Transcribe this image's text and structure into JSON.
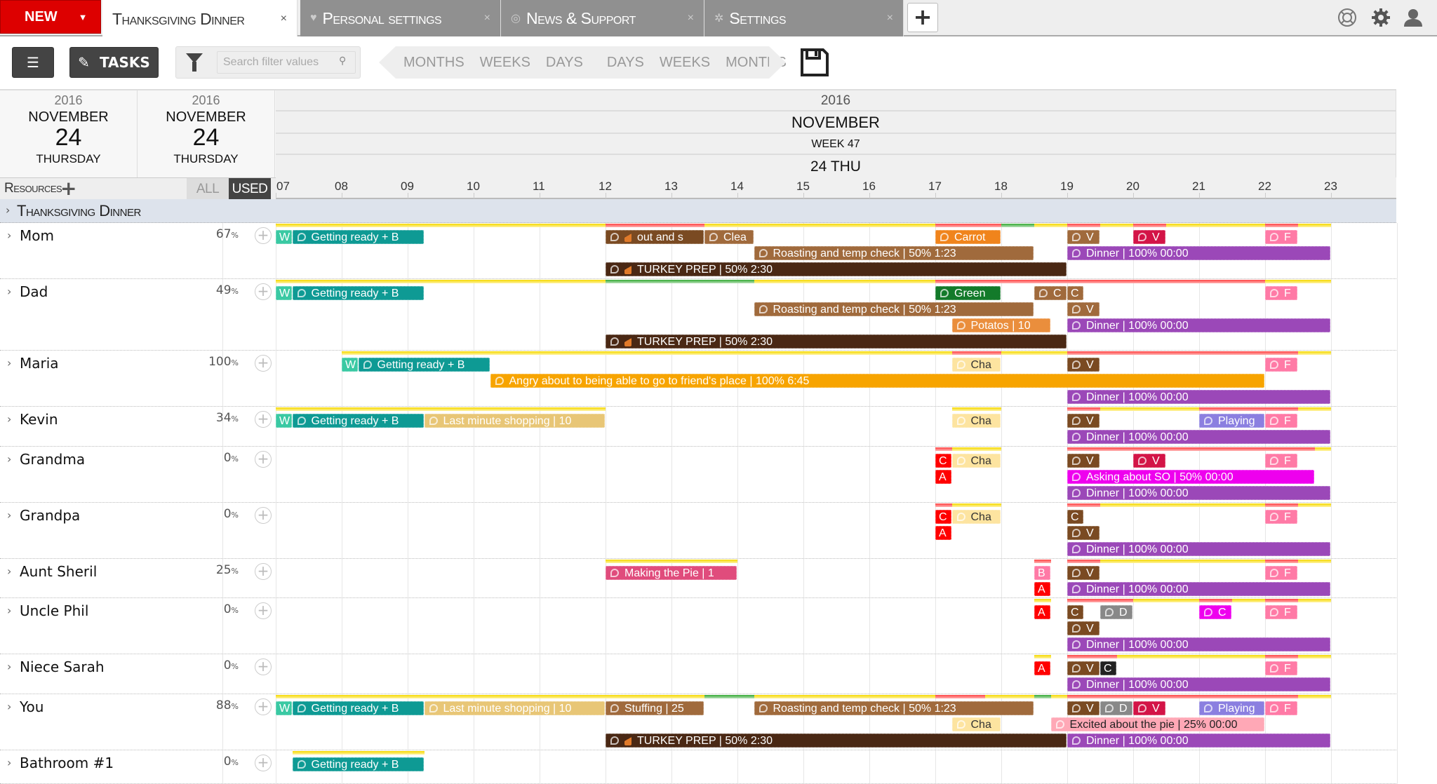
{
  "tabbar": {
    "new_label": "NEW",
    "tabs": [
      {
        "label": "Thanksgiving Dinner",
        "active": true,
        "icon": ""
      },
      {
        "label": "Personal settings",
        "active": false,
        "icon": "heart-icon"
      },
      {
        "label": "News & Support",
        "active": false,
        "icon": "lifebuoy-icon"
      },
      {
        "label": "Settings",
        "active": false,
        "icon": "gear-icon"
      }
    ],
    "close_glyph": "×",
    "add_glyph": "+"
  },
  "toolbar": {
    "tasks_label": "TASKS",
    "search_placeholder": "Search filter values",
    "zoom_out": [
      "MONTHS",
      "WEEKS",
      "DAYS"
    ],
    "zoom_in": [
      "DAYS",
      "WEEKS",
      "MONTHS"
    ]
  },
  "header": {
    "left_dates": [
      {
        "year": "2016",
        "month": "NOVEMBER",
        "day": "24",
        "weekday": "THURSDAY"
      },
      {
        "year": "2016",
        "month": "NOVEMBER",
        "day": "24",
        "weekday": "THURSDAY"
      }
    ],
    "year": "2016",
    "month": "NOVEMBER",
    "week": "WEEK 47",
    "day": "24 THU",
    "hours": [
      "07",
      "08",
      "09",
      "10",
      "11",
      "12",
      "13",
      "14",
      "15",
      "16",
      "17",
      "18",
      "19",
      "20",
      "21",
      "22",
      "23"
    ]
  },
  "resources": {
    "label": "Resources",
    "all_label": "ALL",
    "used_label": "USED"
  },
  "group": {
    "label": "Thanksgiving Dinner"
  },
  "colors": {
    "accent_red": "#dd0000",
    "group_bg": "#dde3ec",
    "dinner": "#9b48b8",
    "turkey_prep": "#4a2814"
  },
  "rows": [
    {
      "name": "Mom",
      "pct": "67",
      "height": 80,
      "load": [
        [
          7,
          12,
          "y"
        ],
        [
          12,
          13.5,
          "r"
        ],
        [
          13.5,
          17,
          "y"
        ],
        [
          17,
          18,
          "r"
        ],
        [
          18,
          18.5,
          "g"
        ],
        [
          18.5,
          19,
          "y"
        ],
        [
          19,
          19.5,
          "r"
        ],
        [
          19.5,
          20,
          "y"
        ],
        [
          20,
          20.5,
          "r"
        ],
        [
          20.5,
          22,
          "y"
        ],
        [
          22,
          22.5,
          "r"
        ],
        [
          22.5,
          23,
          "y"
        ]
      ],
      "tasks": [
        {
          "s": 7,
          "e": 7.25,
          "lane": 0,
          "c": "mint",
          "t": "W",
          "bub": false
        },
        {
          "s": 7.25,
          "e": 9.25,
          "lane": 0,
          "c": "teal",
          "t": "Getting ready + B"
        },
        {
          "s": 12,
          "e": 13.5,
          "lane": 0,
          "c": "brown",
          "t": "out and s",
          "turkey": true
        },
        {
          "s": 13.5,
          "e": 14.25,
          "lane": 0,
          "c": "tan",
          "t": "Clea"
        },
        {
          "s": 17,
          "e": 18,
          "lane": 0,
          "c": "orange",
          "t": "Carrot"
        },
        {
          "s": 19,
          "e": 19.5,
          "lane": 0,
          "c": "tan",
          "t": "V",
          "stripe": true
        },
        {
          "s": 20,
          "e": 20.5,
          "lane": 0,
          "c": "crim",
          "t": "V"
        },
        {
          "s": 22,
          "e": 22.5,
          "lane": 0,
          "c": "pink",
          "t": "F"
        },
        {
          "s": 14.25,
          "e": 18.5,
          "lane": 1,
          "c": "tan",
          "t": "Roasting and temp check | 50% 1:23",
          "stripe": true
        },
        {
          "s": 19,
          "e": 23,
          "lane": 1,
          "c": "purple",
          "t": "Dinner | 100% 00:00"
        },
        {
          "s": 12,
          "e": 19,
          "lane": 2,
          "c": "dark",
          "t": "TURKEY PREP | 50% 2:30",
          "turkey": true
        }
      ]
    },
    {
      "name": "Dad",
      "pct": "49",
      "height": 102,
      "load": [
        [
          7,
          12,
          "y"
        ],
        [
          12,
          14.25,
          "g"
        ],
        [
          14.25,
          17,
          "y"
        ],
        [
          17,
          22,
          "r"
        ],
        [
          22,
          23,
          "y"
        ]
      ],
      "tasks": [
        {
          "s": 7,
          "e": 7.25,
          "lane": 0,
          "c": "mint",
          "t": "W",
          "bub": false
        },
        {
          "s": 7.25,
          "e": 9.25,
          "lane": 0,
          "c": "teal",
          "t": "Getting ready + B"
        },
        {
          "s": 17,
          "e": 18,
          "lane": 0,
          "c": "green",
          "t": "Green"
        },
        {
          "s": 18.5,
          "e": 19,
          "lane": 0,
          "c": "tan",
          "t": "C",
          "stripe": true
        },
        {
          "s": 19,
          "e": 19.25,
          "lane": 0,
          "c": "tan",
          "t": "C",
          "bub": false,
          "stripe": true
        },
        {
          "s": 22,
          "e": 22.5,
          "lane": 0,
          "c": "pink",
          "t": "F"
        },
        {
          "s": 14.25,
          "e": 18.5,
          "lane": 1,
          "c": "tan",
          "t": "Roasting and temp check | 50% 1:23",
          "stripe": true
        },
        {
          "s": 19,
          "e": 19.5,
          "lane": 1,
          "c": "tan",
          "t": "V",
          "stripe": true
        },
        {
          "s": 17.25,
          "e": 18.75,
          "lane": 2,
          "c": "potato",
          "t": "Potatos | 10"
        },
        {
          "s": 19,
          "e": 23,
          "lane": 2,
          "c": "purple",
          "t": "Dinner | 100% 00:00"
        },
        {
          "s": 12,
          "e": 19,
          "lane": 3,
          "c": "dark",
          "t": "TURKEY PREP | 50% 2:30",
          "turkey": true
        }
      ]
    },
    {
      "name": "Maria",
      "pct": "100",
      "height": 80,
      "load": [
        [
          8,
          17.25,
          "y"
        ],
        [
          17.25,
          18,
          "r"
        ],
        [
          18,
          19,
          "y"
        ],
        [
          19,
          22.5,
          "r"
        ],
        [
          22.5,
          23,
          "y"
        ]
      ],
      "tasks": [
        {
          "s": 8,
          "e": 8.25,
          "lane": 0,
          "c": "mint",
          "t": "W",
          "bub": false,
          "stripe": true
        },
        {
          "s": 8.25,
          "e": 10.25,
          "lane": 0,
          "c": "teal",
          "t": "Getting ready + B",
          "stripe": true
        },
        {
          "s": 17.25,
          "e": 18,
          "lane": 0,
          "c": "yellow",
          "t": "Cha"
        },
        {
          "s": 19,
          "e": 19.5,
          "lane": 0,
          "c": "brown",
          "t": "V",
          "stripe": true
        },
        {
          "s": 22,
          "e": 22.5,
          "lane": 0,
          "c": "pink",
          "t": "F"
        },
        {
          "s": 10.25,
          "e": 22,
          "lane": 1,
          "c": "amber",
          "t": "Angry about to being able to go to friend's place | 100% 6:45"
        },
        {
          "s": 19,
          "e": 23,
          "lane": 2,
          "c": "purple",
          "t": "Dinner | 100% 00:00"
        }
      ]
    },
    {
      "name": "Kevin",
      "pct": "34",
      "height": 57,
      "load": [
        [
          7,
          12,
          "y"
        ],
        [
          17.25,
          18,
          "y"
        ],
        [
          19,
          19.5,
          "r"
        ],
        [
          19.5,
          21,
          "y"
        ],
        [
          21,
          22.5,
          "r"
        ],
        [
          22.5,
          23,
          "y"
        ]
      ],
      "tasks": [
        {
          "s": 7,
          "e": 7.25,
          "lane": 0,
          "c": "mint",
          "t": "W",
          "bub": false
        },
        {
          "s": 7.25,
          "e": 9.25,
          "lane": 0,
          "c": "teal",
          "t": "Getting ready + B"
        },
        {
          "s": 9.25,
          "e": 12,
          "lane": 0,
          "c": "shop",
          "t": "Last minute shopping | 10",
          "stripe": true
        },
        {
          "s": 17.25,
          "e": 18,
          "lane": 0,
          "c": "yellow",
          "t": "Cha"
        },
        {
          "s": 19,
          "e": 19.5,
          "lane": 0,
          "c": "brown",
          "t": "V",
          "stripe": true
        },
        {
          "s": 21,
          "e": 22,
          "lane": 0,
          "c": "lav",
          "t": "Playing"
        },
        {
          "s": 22,
          "e": 22.5,
          "lane": 0,
          "c": "pink",
          "t": "F"
        },
        {
          "s": 19,
          "e": 23,
          "lane": 1,
          "c": "purple",
          "t": "Dinner | 100% 00:00"
        }
      ]
    },
    {
      "name": "Grandma",
      "pct": "0",
      "height": 80,
      "load": [
        [
          17,
          17.25,
          "r"
        ],
        [
          17.25,
          18,
          "y"
        ],
        [
          19,
          22.75,
          "r"
        ],
        [
          22.75,
          23,
          "y"
        ]
      ],
      "tasks": [
        {
          "s": 17,
          "e": 17.25,
          "lane": 0,
          "c": "red",
          "t": "C",
          "bub": false,
          "stripe": true
        },
        {
          "s": 17.25,
          "e": 18,
          "lane": 0,
          "c": "yellow",
          "t": "Cha"
        },
        {
          "s": 19,
          "e": 19.5,
          "lane": 0,
          "c": "brown",
          "t": "V",
          "stripe": true
        },
        {
          "s": 20,
          "e": 20.5,
          "lane": 0,
          "c": "crim",
          "t": "V"
        },
        {
          "s": 22,
          "e": 22.5,
          "lane": 0,
          "c": "pink",
          "t": "F"
        },
        {
          "s": 17,
          "e": 17.25,
          "lane": 1,
          "c": "red",
          "t": "A",
          "bub": false
        },
        {
          "s": 19,
          "e": 22.75,
          "lane": 1,
          "c": "magenta",
          "t": "Asking about SO | 50% 00:00"
        },
        {
          "s": 19,
          "e": 23,
          "lane": 2,
          "c": "purple",
          "t": "Dinner | 100% 00:00"
        }
      ]
    },
    {
      "name": "Grandpa",
      "pct": "0",
      "height": 80,
      "load": [
        [
          17,
          17.25,
          "r"
        ],
        [
          17.25,
          18,
          "y"
        ],
        [
          19,
          19.5,
          "r"
        ],
        [
          19.5,
          22,
          "y"
        ],
        [
          22,
          22.5,
          "r"
        ],
        [
          22.5,
          23,
          "y"
        ]
      ],
      "tasks": [
        {
          "s": 17,
          "e": 17.25,
          "lane": 0,
          "c": "red",
          "t": "C",
          "bub": false,
          "stripe": true
        },
        {
          "s": 17.25,
          "e": 18,
          "lane": 0,
          "c": "yellow",
          "t": "Cha"
        },
        {
          "s": 19,
          "e": 19.25,
          "lane": 0,
          "c": "brown",
          "t": "C",
          "bub": false,
          "stripe": true
        },
        {
          "s": 22,
          "e": 22.5,
          "lane": 0,
          "c": "pink",
          "t": "F"
        },
        {
          "s": 17,
          "e": 17.25,
          "lane": 1,
          "c": "red",
          "t": "A",
          "bub": false
        },
        {
          "s": 19,
          "e": 19.5,
          "lane": 1,
          "c": "brown",
          "t": "V",
          "stripe": true
        },
        {
          "s": 19,
          "e": 23,
          "lane": 2,
          "c": "purple",
          "t": "Dinner | 100% 00:00"
        }
      ]
    },
    {
      "name": "Aunt Sheril",
      "pct": "25",
      "height": 56,
      "load": [
        [
          12,
          14,
          "y"
        ],
        [
          18.5,
          18.75,
          "r"
        ],
        [
          19,
          19.5,
          "r"
        ],
        [
          19.5,
          22,
          "y"
        ],
        [
          22,
          22.5,
          "r"
        ],
        [
          22.5,
          23,
          "y"
        ]
      ],
      "tasks": [
        {
          "s": 12,
          "e": 14,
          "lane": 0,
          "c": "pie",
          "t": "Making the Pie | 1",
          "stripe": true
        },
        {
          "s": 18.5,
          "e": 18.75,
          "lane": 0,
          "c": "pink",
          "t": "B",
          "bub": false,
          "stripe": true
        },
        {
          "s": 19,
          "e": 19.5,
          "lane": 0,
          "c": "brown",
          "t": "V",
          "stripe": true
        },
        {
          "s": 22,
          "e": 22.5,
          "lane": 0,
          "c": "pink",
          "t": "F"
        },
        {
          "s": 18.5,
          "e": 18.75,
          "lane": 1,
          "c": "red",
          "t": "A",
          "bub": false
        },
        {
          "s": 19,
          "e": 23,
          "lane": 1,
          "c": "purple",
          "t": "Dinner | 100% 00:00"
        }
      ]
    },
    {
      "name": "Uncle Phil",
      "pct": "0",
      "height": 80,
      "load": [
        [
          18.5,
          18.75,
          "y"
        ],
        [
          19,
          20,
          "r"
        ],
        [
          20,
          21,
          "y"
        ],
        [
          21,
          21.5,
          "r"
        ],
        [
          21.5,
          22,
          "y"
        ],
        [
          22,
          22.5,
          "r"
        ],
        [
          22.5,
          23,
          "y"
        ]
      ],
      "tasks": [
        {
          "s": 18.5,
          "e": 18.75,
          "lane": 0,
          "c": "red",
          "t": "A",
          "bub": false
        },
        {
          "s": 19,
          "e": 19.25,
          "lane": 0,
          "c": "brown",
          "t": "C",
          "bub": false,
          "stripe": true
        },
        {
          "s": 19.5,
          "e": 20,
          "lane": 0,
          "c": "gray",
          "t": "D"
        },
        {
          "s": 21,
          "e": 21.5,
          "lane": 0,
          "c": "magenta",
          "t": "C"
        },
        {
          "s": 22,
          "e": 22.5,
          "lane": 0,
          "c": "pink",
          "t": "F"
        },
        {
          "s": 19,
          "e": 19.5,
          "lane": 1,
          "c": "brown",
          "t": "V",
          "stripe": true
        },
        {
          "s": 19,
          "e": 23,
          "lane": 2,
          "c": "purple",
          "t": "Dinner | 100% 00:00"
        }
      ]
    },
    {
      "name": "Niece Sarah",
      "pct": "0",
      "height": 57,
      "load": [
        [
          18.5,
          18.75,
          "y"
        ],
        [
          19,
          19.75,
          "r"
        ],
        [
          19.75,
          22,
          "y"
        ],
        [
          22,
          22.5,
          "r"
        ],
        [
          22.5,
          23,
          "y"
        ]
      ],
      "tasks": [
        {
          "s": 18.5,
          "e": 18.75,
          "lane": 0,
          "c": "red",
          "t": "A",
          "bub": false
        },
        {
          "s": 19,
          "e": 19.5,
          "lane": 0,
          "c": "brown",
          "t": "V",
          "stripe": true
        },
        {
          "s": 19.5,
          "e": 19.75,
          "lane": 0,
          "c": "black",
          "t": "C",
          "bub": false
        },
        {
          "s": 22,
          "e": 22.5,
          "lane": 0,
          "c": "pink",
          "t": "F"
        },
        {
          "s": 19,
          "e": 23,
          "lane": 1,
          "c": "purple",
          "t": "Dinner | 100% 00:00"
        }
      ]
    },
    {
      "name": "You",
      "pct": "88",
      "height": 80,
      "load": [
        [
          7,
          13.5,
          "y"
        ],
        [
          13.5,
          14.25,
          "g"
        ],
        [
          14.25,
          17,
          "y"
        ],
        [
          17,
          17.75,
          "r"
        ],
        [
          17.75,
          18.5,
          "y"
        ],
        [
          18.5,
          18.75,
          "g"
        ],
        [
          18.75,
          19,
          "y"
        ],
        [
          19,
          22.5,
          "r"
        ],
        [
          22.5,
          23,
          "y"
        ]
      ],
      "tasks": [
        {
          "s": 7,
          "e": 7.25,
          "lane": 0,
          "c": "mint",
          "t": "W",
          "bub": false
        },
        {
          "s": 7.25,
          "e": 9.25,
          "lane": 0,
          "c": "teal",
          "t": "Getting ready + B"
        },
        {
          "s": 9.25,
          "e": 12,
          "lane": 0,
          "c": "shop",
          "t": "Last minute shopping | 10",
          "stripe": true
        },
        {
          "s": 12,
          "e": 13.5,
          "lane": 0,
          "c": "tan",
          "t": "Stuffing | 25"
        },
        {
          "s": 14.25,
          "e": 18.5,
          "lane": 0,
          "c": "tan",
          "t": "Roasting and temp check | 50% 1:23",
          "stripe": true
        },
        {
          "s": 19,
          "e": 19.5,
          "lane": 0,
          "c": "brown",
          "t": "V",
          "stripe": true
        },
        {
          "s": 19.5,
          "e": 20,
          "lane": 0,
          "c": "gray",
          "t": "D"
        },
        {
          "s": 20,
          "e": 20.5,
          "lane": 0,
          "c": "crim",
          "t": "V"
        },
        {
          "s": 21,
          "e": 22,
          "lane": 0,
          "c": "lav",
          "t": "Playing"
        },
        {
          "s": 22,
          "e": 22.5,
          "lane": 0,
          "c": "pink",
          "t": "F"
        },
        {
          "s": 17.25,
          "e": 18,
          "lane": 1,
          "c": "yellow",
          "t": "Cha"
        },
        {
          "s": 18.75,
          "e": 22,
          "lane": 1,
          "c": "lpink",
          "t": "Excited about the pie | 25% 00:00"
        },
        {
          "s": 12,
          "e": 19,
          "lane": 2,
          "c": "dark",
          "t": "TURKEY PREP | 50% 2:30",
          "turkey": true
        },
        {
          "s": 19,
          "e": 23,
          "lane": 2,
          "c": "purple",
          "t": "Dinner | 100% 00:00"
        }
      ]
    },
    {
      "name": "Bathroom #1",
      "pct": "0",
      "height": 48,
      "load": [
        [
          7.25,
          9.25,
          "y"
        ]
      ],
      "tasks": [
        {
          "s": 7.25,
          "e": 9.25,
          "lane": 0,
          "c": "teal",
          "t": "Getting ready + B"
        }
      ]
    }
  ]
}
